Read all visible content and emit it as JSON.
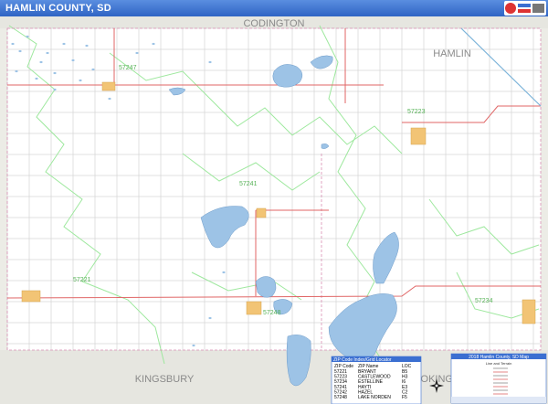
{
  "header": {
    "title": "HAMLIN COUNTY, SD"
  },
  "map": {
    "neighbors": {
      "north": "CODINGTON",
      "northeast": "HAMLIN",
      "south": "KINGSBURY",
      "southeast": "BROOKINGS"
    },
    "zip_labels": [
      "57247",
      "57223",
      "57241",
      "57221",
      "57248",
      "57234"
    ],
    "colors": {
      "lake": "#9dc3e6",
      "town": "#f2c475",
      "grid": "#d0d0d0",
      "highway": "#e06666",
      "zip": "#9ee89e",
      "neighbor": "#e6e6e0",
      "title": "#3b6fd1"
    }
  },
  "locator": {
    "title": "ZIP Code Index/Grid Locator",
    "headers": [
      "ZIP Code",
      "ZIP Name",
      "LOC"
    ],
    "rows": [
      [
        "57221",
        "BRYANT",
        "B5"
      ],
      [
        "57223",
        "CASTLEWOOD",
        "H3"
      ],
      [
        "57234",
        "ESTELLINE",
        "I6"
      ],
      [
        "57241",
        "HAYTI",
        "E3"
      ],
      [
        "57242",
        "HAZEL",
        "C2"
      ],
      [
        "57248",
        "LAKE NORDEN",
        "F5"
      ]
    ]
  },
  "legend": {
    "title": "2018 Hamlin County, SD Map",
    "header": "Line and Terrain",
    "rows": [
      "",
      "",
      "",
      "",
      "",
      "",
      "",
      ""
    ]
  }
}
